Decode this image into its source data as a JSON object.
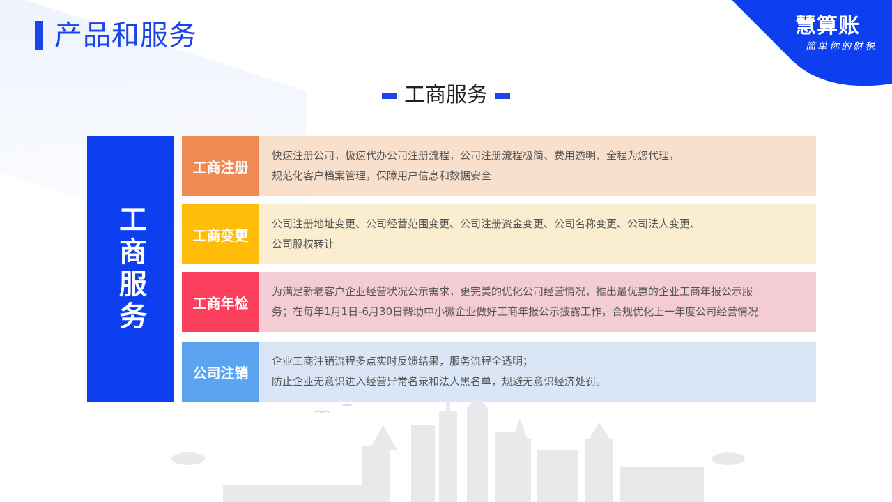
{
  "page_title": "产品和服务",
  "brand": {
    "name": "慧算账",
    "slogan": "简单你的财税",
    "color": "#0d3ff0"
  },
  "section_heading": "工商服务",
  "vertical_label": "工商服务",
  "rows": [
    {
      "label": "工商注册",
      "label_color": "#ee8a52",
      "bg_color": "#f9e0cd",
      "lines": [
        "快速注册公司，极速代办公司注册流程，公司注册流程极简、费用透明、全程为您代理，",
        "规范化客户档案管理，保障用户信息和数据安全"
      ]
    },
    {
      "label": "工商变更",
      "label_color": "#ffbd0a",
      "bg_color": "#fbeed0",
      "lines": [
        "公司注册地址变更、公司经营范围变更、公司注册资金变更、公司名称变更、公司法人变更、",
        "公司股权转让"
      ]
    },
    {
      "label": "工商年检",
      "label_color": "#fd3f5e",
      "bg_color": "#f3cdd3",
      "lines": [
        "为满足新老客户企业经营状况公示需求，更完美的优化公司经营情况，推出最优惠的企业工商年报公示服",
        "务；在每年1月1日-6月30日帮助中小微企业做好工商年报公示披露工作，合规优化上一年度公司经营情况"
      ]
    },
    {
      "label": "公司注销",
      "label_color": "#5ba4f0",
      "bg_color": "#dae6f6",
      "lines": [
        "企业工商注销流程多点实时反馈结果，服务流程全透明；",
        "防止企业无意识进入经营异常名录和法人黑名单，规避无意识经济处罚。"
      ]
    }
  ]
}
